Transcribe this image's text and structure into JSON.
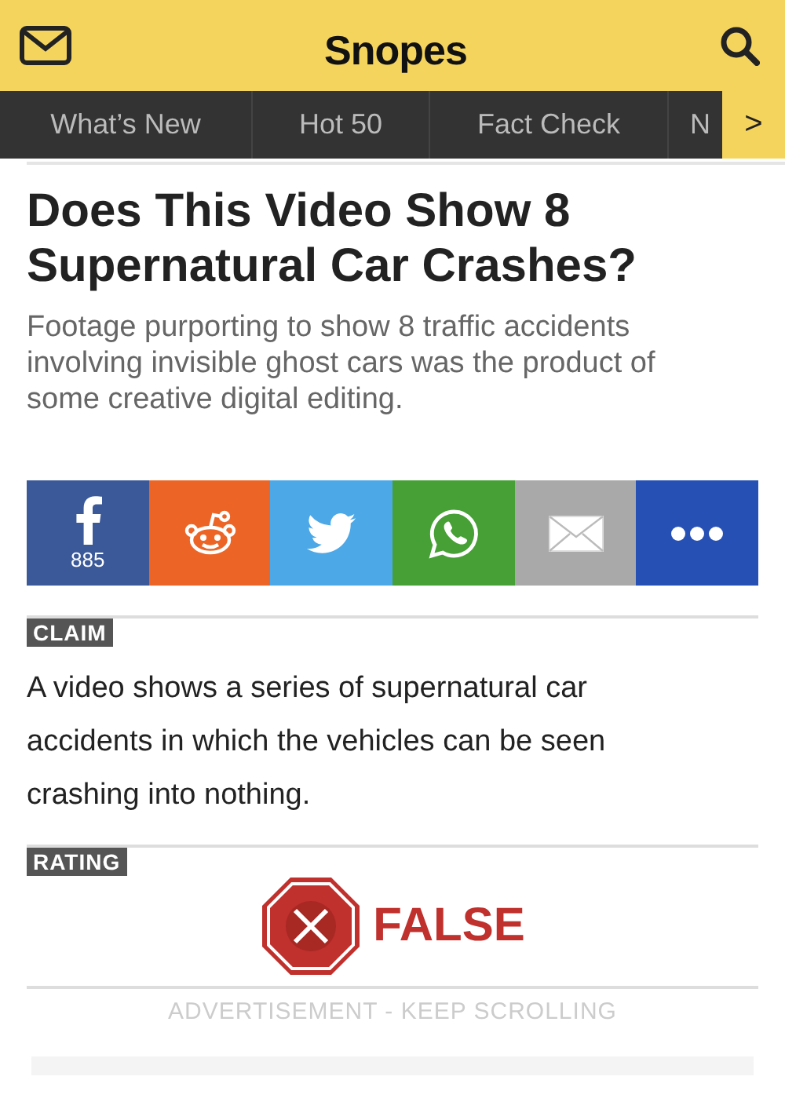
{
  "header": {
    "logo": "Snopes"
  },
  "nav": {
    "tabs": [
      {
        "label": "What’s New"
      },
      {
        "label": "Hot 50"
      },
      {
        "label": "Fact Check"
      },
      {
        "label": "N"
      }
    ],
    "more": ">"
  },
  "article": {
    "title": "Does This Video Show 8 Supernatural Car Crashes?",
    "subtitle": "Footage purporting to show 8 traffic accidents involving invisible ghost cars was the product of some creative digital editing."
  },
  "share": [
    {
      "kind": "facebook",
      "color": "#3b5998",
      "count": "885"
    },
    {
      "kind": "reddit",
      "color": "#ec6527"
    },
    {
      "kind": "twitter",
      "color": "#4ca8e6"
    },
    {
      "kind": "whatsapp",
      "color": "#46a035"
    },
    {
      "kind": "email",
      "color": "#a9a9a9"
    },
    {
      "kind": "more",
      "color": "#2750b4"
    }
  ],
  "claim": {
    "tag": "CLAIM",
    "text": "A video shows a series of supernatural car accidents in which the vehicles can be seen crashing into nothing."
  },
  "rating": {
    "tag": "RATING",
    "verdict": "FALSE"
  },
  "ad_label": "ADVERTISEMENT - KEEP SCROLLING"
}
